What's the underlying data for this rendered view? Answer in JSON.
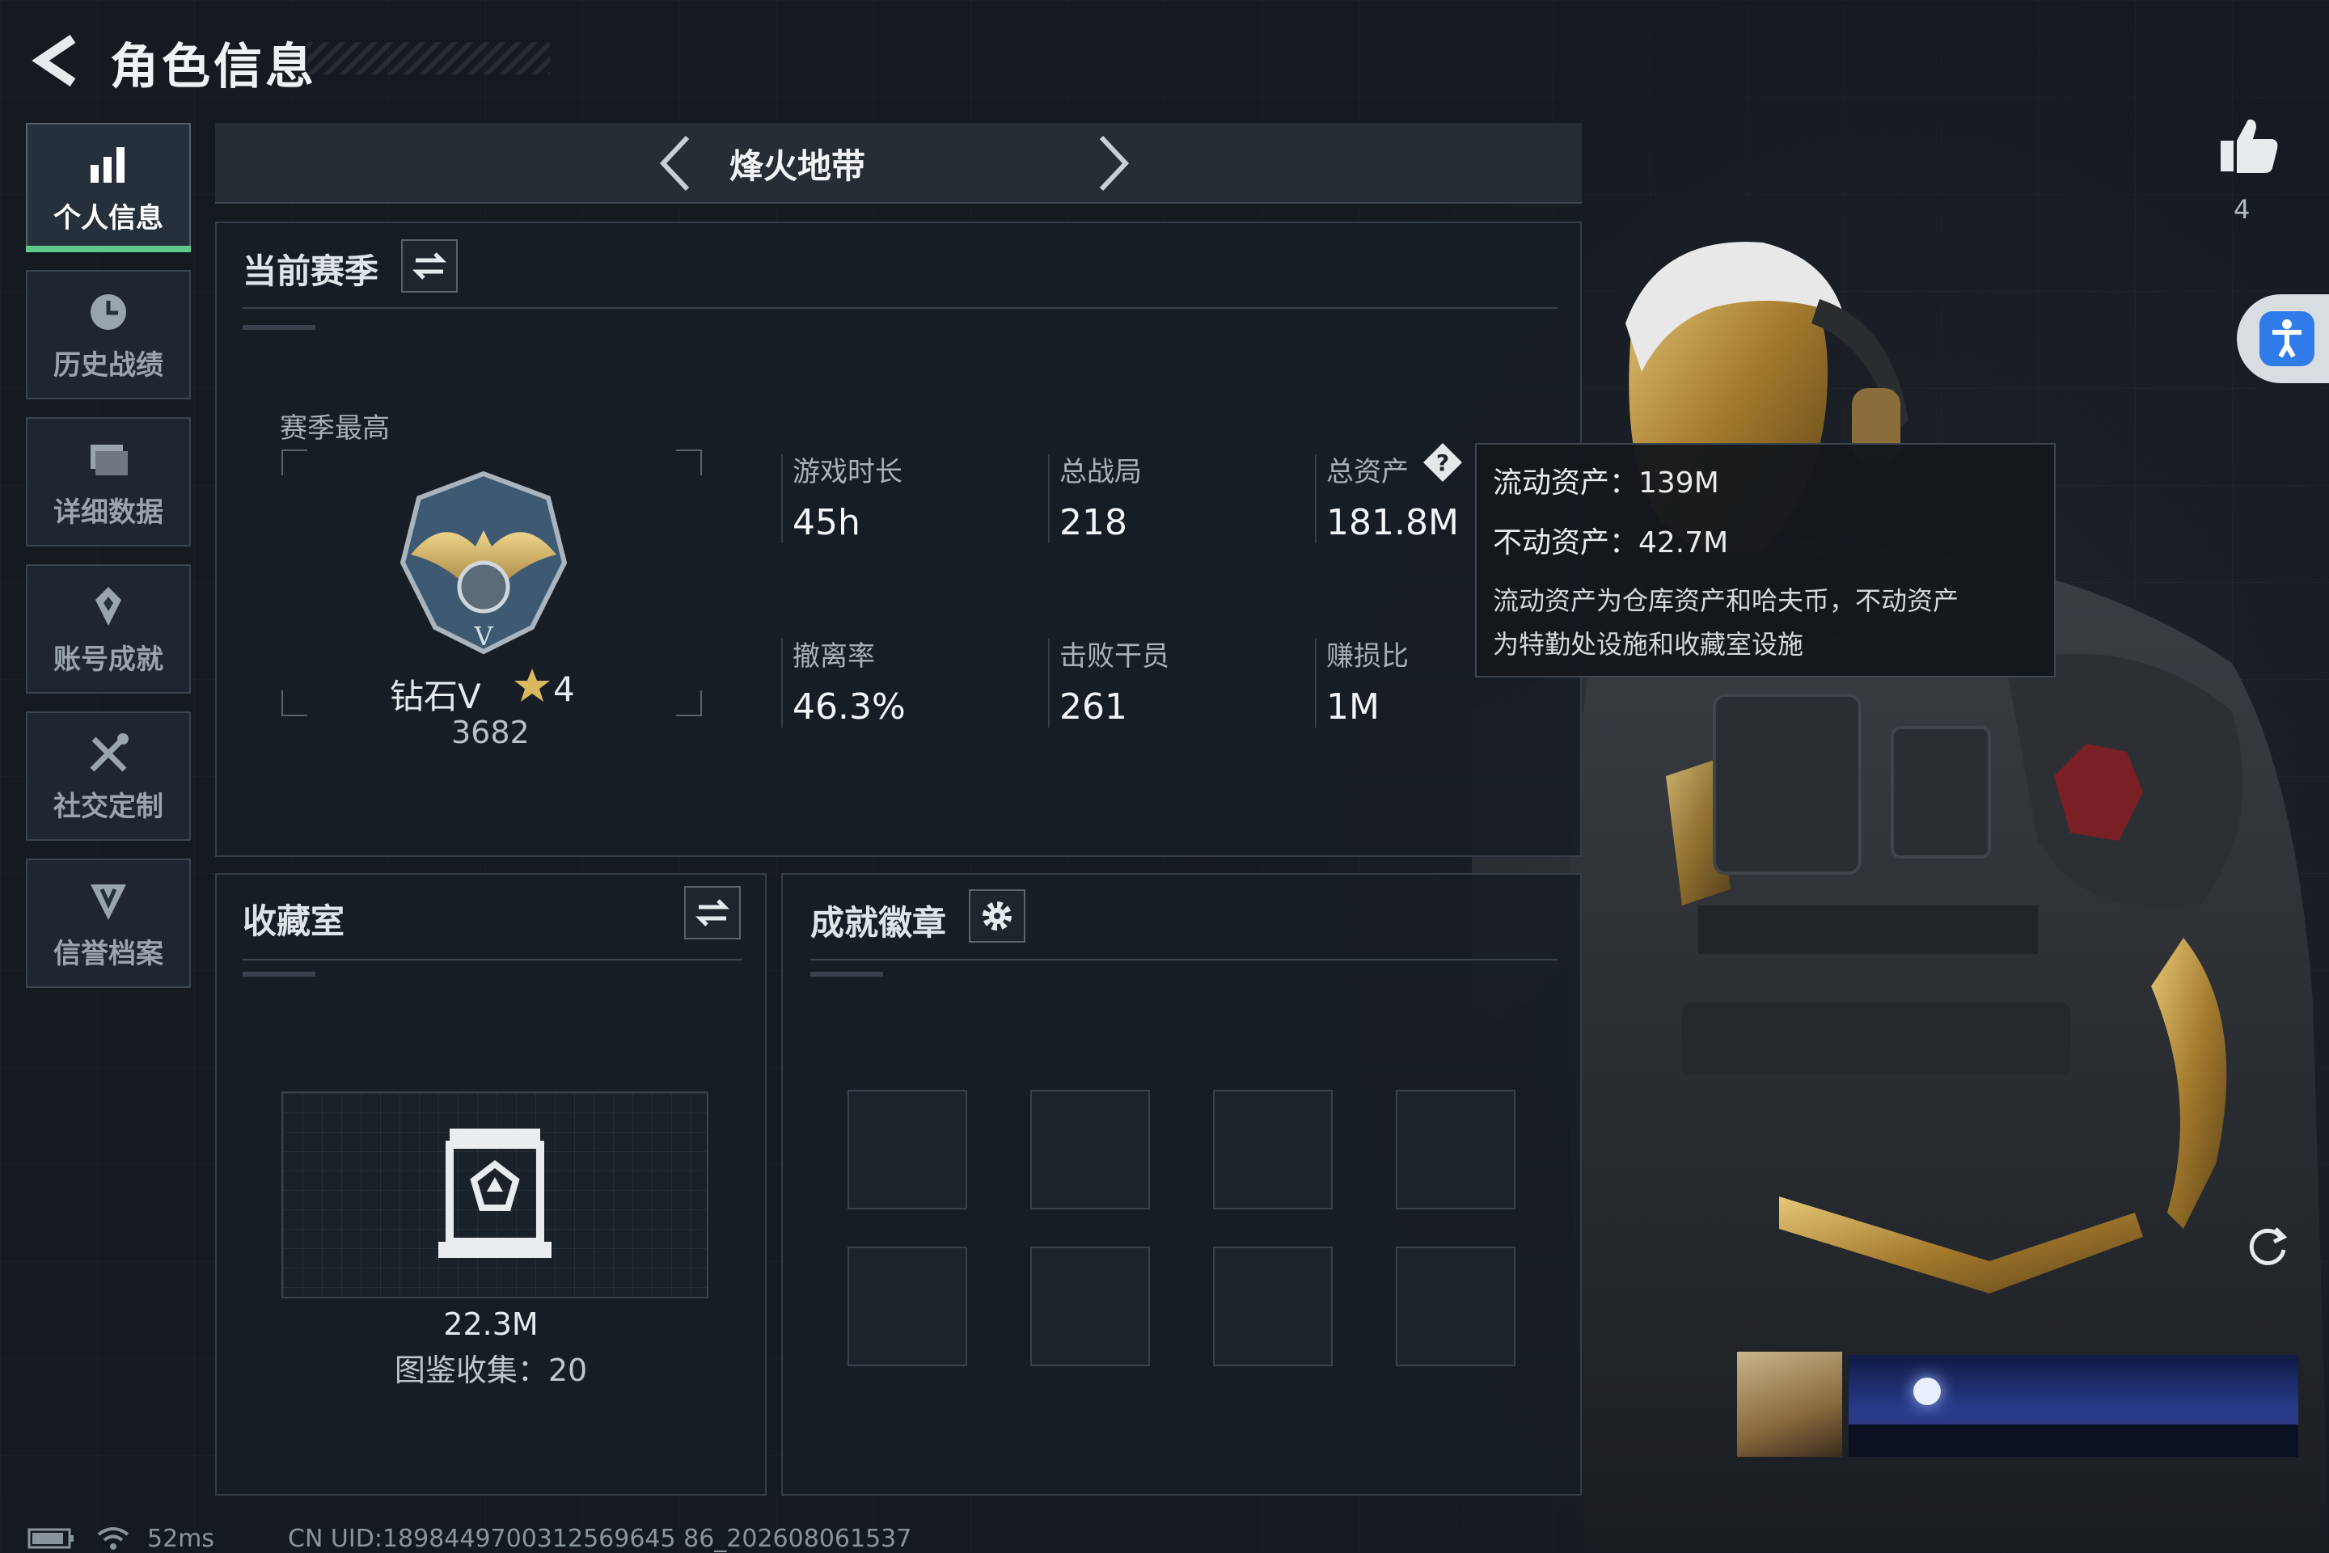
{
  "header": {
    "title": "角色信息"
  },
  "sidebar": {
    "items": [
      {
        "label": "个人信息",
        "icon": "bar-chart-icon",
        "active": true
      },
      {
        "label": "历史战绩",
        "icon": "history-icon",
        "active": false
      },
      {
        "label": "详细数据",
        "icon": "data-folder-icon",
        "active": false
      },
      {
        "label": "账号成就",
        "icon": "achievement-icon",
        "active": false
      },
      {
        "label": "社交定制",
        "icon": "tools-icon",
        "active": false
      },
      {
        "label": "信誉档案",
        "icon": "credit-icon",
        "active": false
      }
    ]
  },
  "mode": {
    "title": "烽火地带"
  },
  "season": {
    "title": "当前赛季",
    "best_label": "赛季最高",
    "rank_name": "钻石V",
    "rank_stars": "4",
    "rank_score": "3682",
    "stats": [
      {
        "label": "游戏时长",
        "value": "45h"
      },
      {
        "label": "总战局",
        "value": "218"
      },
      {
        "label": "总资产",
        "value": "181.8M"
      },
      {
        "label": "撤离率",
        "value": "46.3%"
      },
      {
        "label": "击败干员",
        "value": "261"
      },
      {
        "label": "赚损比",
        "value": "1M"
      }
    ]
  },
  "tooltip": {
    "liquid": "流动资产：139M",
    "fixed": "不动资产：42.7M",
    "desc_line1": "流动资产为仓库资产和哈夫币，不动资产",
    "desc_line2": "为特勤处设施和收藏室设施"
  },
  "collection": {
    "title": "收藏室",
    "value": "22.3M",
    "count": "图鉴收集：20"
  },
  "badges": {
    "title": "成就徽章"
  },
  "social": {
    "likes": "4"
  },
  "status": {
    "ping": "52ms",
    "uid": "CN UID:1898449700312569645 86_202608061537"
  },
  "colors": {
    "accent": "#5fc88a",
    "gold": "#c8a24a",
    "access_blue": "#2f7bea"
  }
}
